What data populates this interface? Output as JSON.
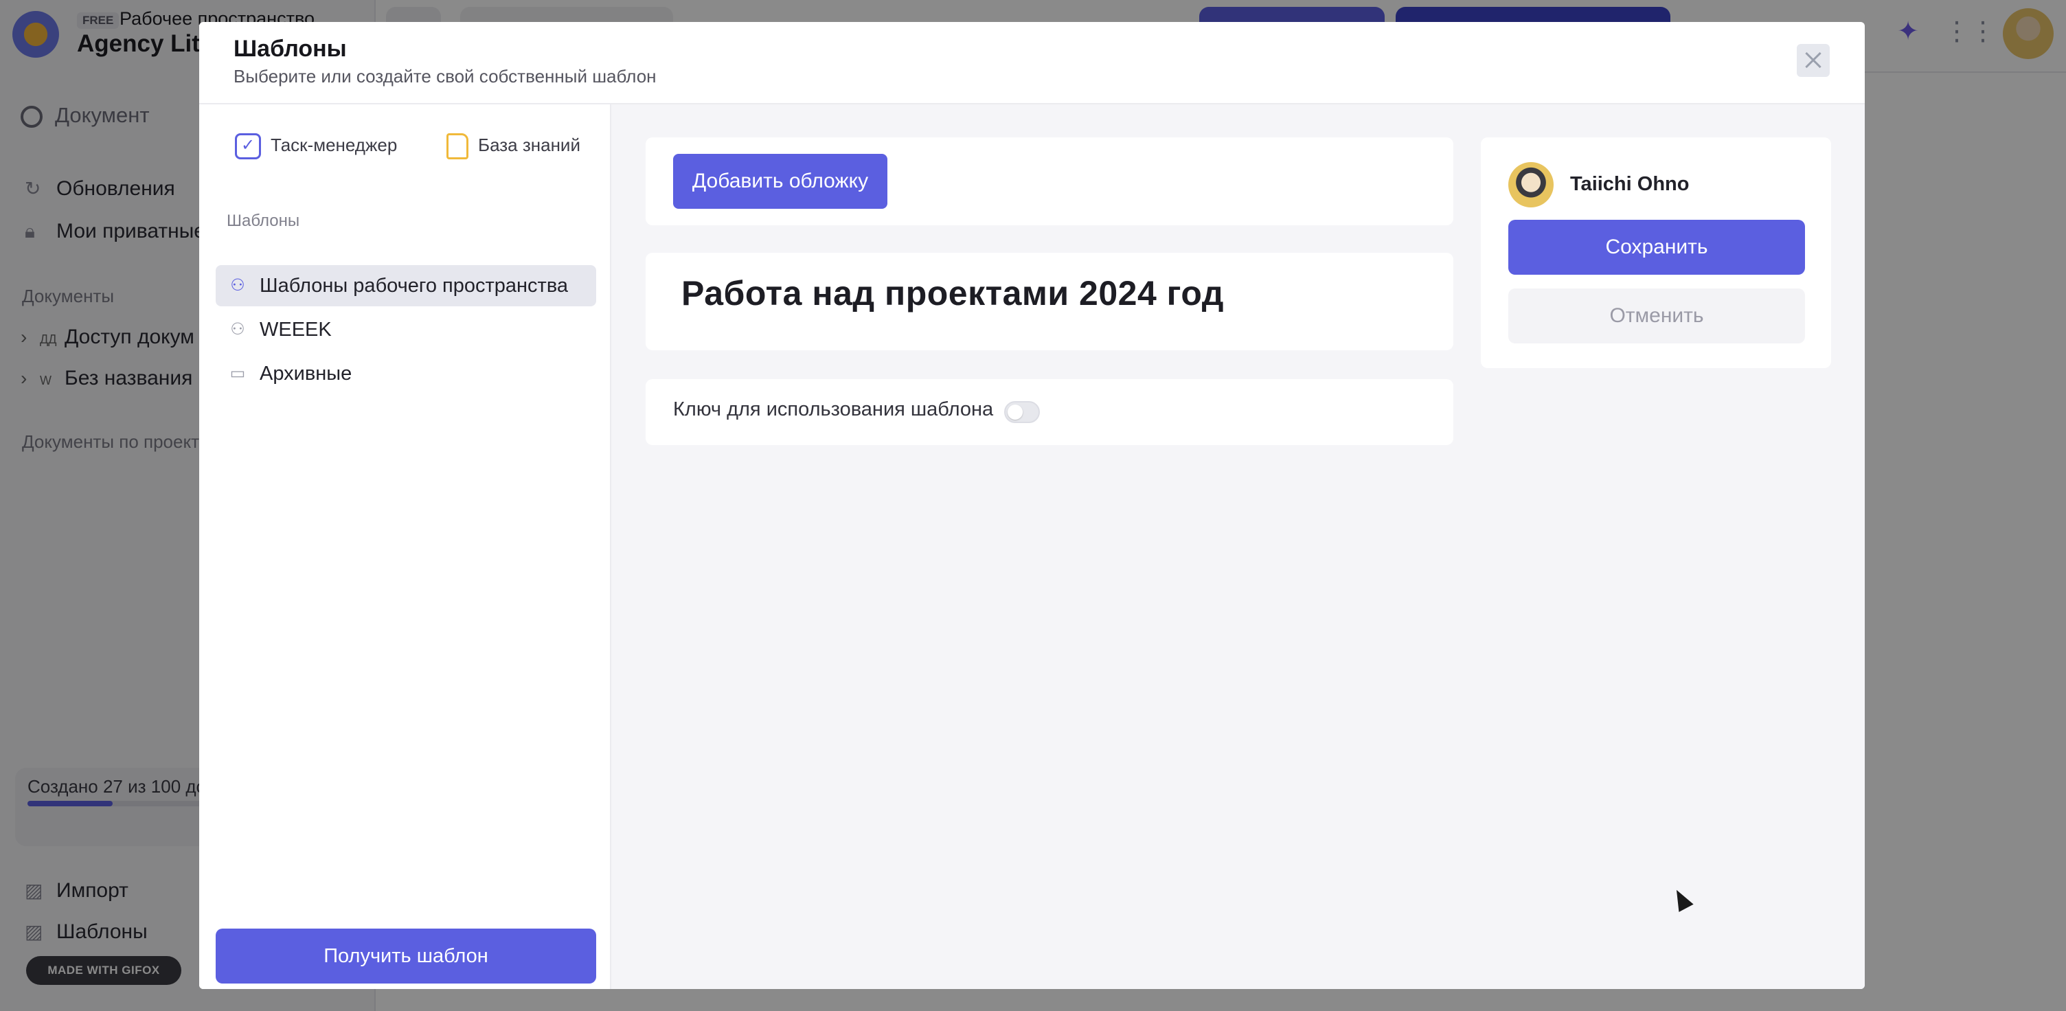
{
  "background": {
    "workspace": {
      "badge": "FREE",
      "label": "Рабочее пространство",
      "name": "Agency Lite"
    },
    "sidebar": {
      "search_placeholder": "Документ",
      "items": [
        {
          "label": "Обновления",
          "icon": "refresh-icon"
        },
        {
          "label": "Мои приватные",
          "icon": "lock-icon"
        }
      ],
      "section_documents": "Документы",
      "documents": [
        {
          "tag": "ДД",
          "label": "Доступ докум"
        },
        {
          "tag": "W",
          "label": "Без названия"
        }
      ],
      "section_projects": "Документы по проект",
      "quota_text": "Создано 27 из 100 до",
      "quota_fraction": 0.27,
      "bottom_items": [
        {
          "label": "Импорт",
          "icon": "import-icon"
        },
        {
          "label": "Шаблоны",
          "icon": "templates-icon"
        }
      ]
    },
    "gifox_badge": "MADE WITH GIFOX"
  },
  "modal": {
    "title": "Шаблоны",
    "subtitle": "Выберите или создайте свой собственный шаблон",
    "tabs": [
      {
        "label": "Таск-менеджер",
        "icon": "checkbox-icon"
      },
      {
        "label": "База знаний",
        "icon": "document-icon"
      }
    ],
    "section_label": "Шаблоны",
    "template_groups": [
      {
        "label": "Шаблоны рабочего пространства",
        "icon": "users-icon",
        "active": true
      },
      {
        "label": "WEEEK",
        "icon": "users-icon",
        "active": false
      },
      {
        "label": "Архивные",
        "icon": "archive-icon",
        "active": false
      }
    ],
    "get_template_label": "Получить шаблон",
    "add_cover_label": "Добавить обложку",
    "document_title": "Работа над проектами 2024 год",
    "template_key_label": "Ключ для использования шаблона",
    "template_key_enabled": false,
    "author_name": "Taiichi Ohno",
    "save_label": "Сохранить",
    "cancel_label": "Отменить"
  },
  "colors": {
    "accent": "#5b5fe0",
    "overlay": "rgba(0,0,0,0.46)"
  }
}
